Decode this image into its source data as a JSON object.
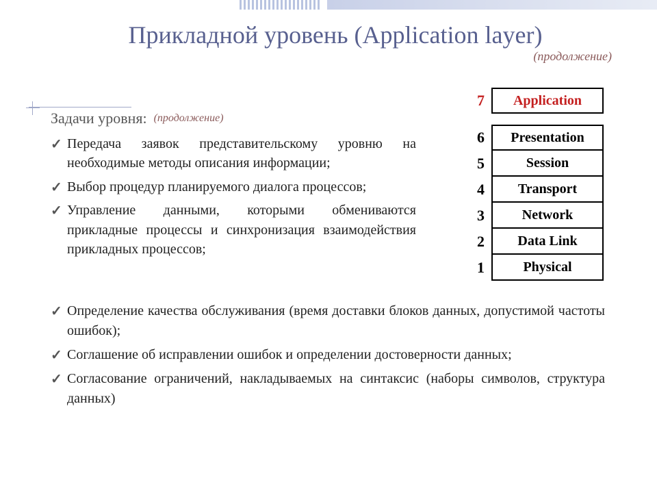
{
  "title": "Прикладной уровень (Application layer)",
  "continuation": "(продолжение)",
  "subhead": "Задачи уровня:",
  "tasks_upper": [
    "Передача заявок представительскому уровню на необходимые методы описания информации;",
    "Выбор процедур планируемого диалога процессов;",
    "Управление данными, которыми обмениваются прикладные процессы и синхронизация взаимодействия прикладных процессов;"
  ],
  "tasks_lower": [
    "Определение качества обслуживания (время доставки блоков данных, допустимой частоты ошибок);",
    "Соглашение об исправлении ошибок и определении достоверности данных;",
    "Согласование ограничений, накладываемых на синтаксис (наборы символов, структура данных)"
  ],
  "osi": [
    {
      "num": "7",
      "label": "Application",
      "highlight": true
    },
    {
      "num": "6",
      "label": "Presentation",
      "highlight": false
    },
    {
      "num": "5",
      "label": "Session",
      "highlight": false
    },
    {
      "num": "4",
      "label": "Transport",
      "highlight": false
    },
    {
      "num": "3",
      "label": "Network",
      "highlight": false
    },
    {
      "num": "2",
      "label": "Data Link",
      "highlight": false
    },
    {
      "num": "1",
      "label": "Physical",
      "highlight": false
    }
  ]
}
